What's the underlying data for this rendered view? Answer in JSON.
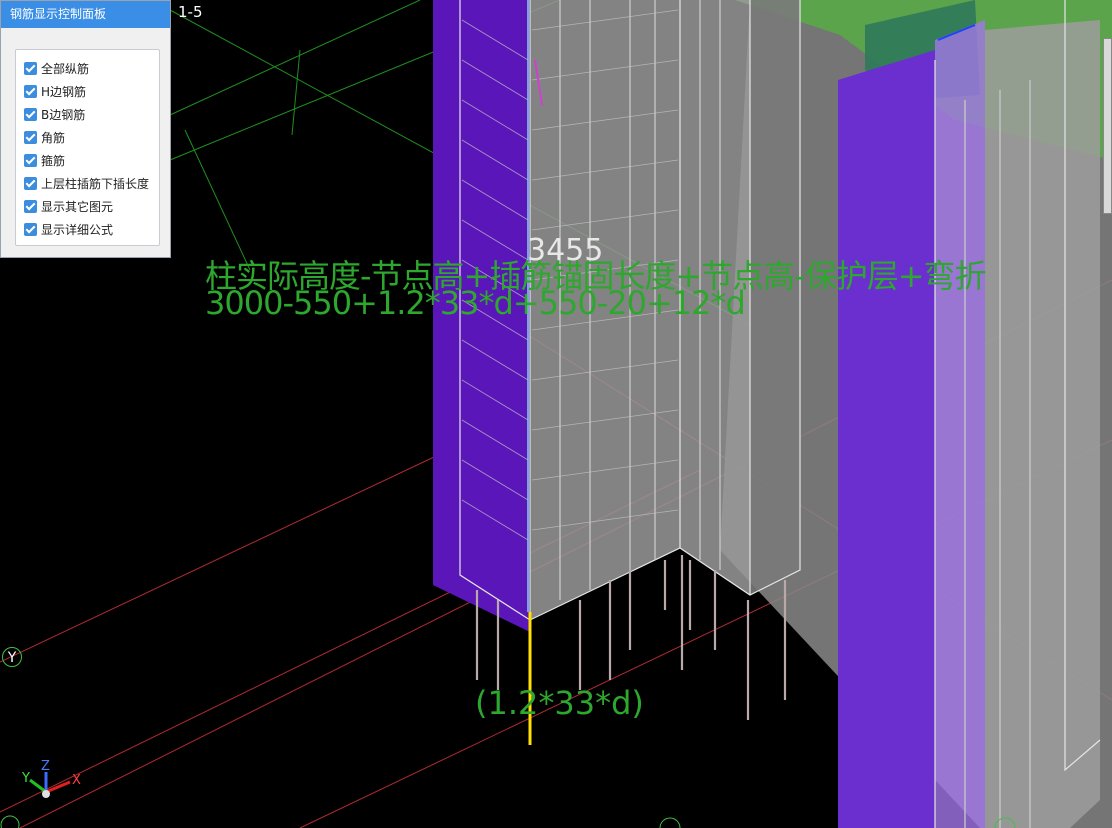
{
  "panel": {
    "title": "钢筋显示控制面板",
    "options": [
      {
        "label": "全部纵筋",
        "checked": true
      },
      {
        "label": "H边钢筋",
        "checked": true
      },
      {
        "label": "B边钢筋",
        "checked": true
      },
      {
        "label": "角筋",
        "checked": true
      },
      {
        "label": "箍筋",
        "checked": true
      },
      {
        "label": "上层柱插筋下插长度",
        "checked": true
      },
      {
        "label": "显示其它图元",
        "checked": true
      },
      {
        "label": "显示详细公式",
        "checked": true
      }
    ]
  },
  "viewport": {
    "grid_label": "1-5",
    "axis_bubble_left": "Y",
    "length_value": "3455",
    "formula_name": "柱实际高度-节点高+插筋锚固长度+节点高-保护层+弯折",
    "formula_expression": "3000-550+1.2*33*d+550-20+12*d",
    "anchor_formula": "(1.2*33*d)",
    "gizmo": {
      "x_label": "X",
      "y_label": "Y",
      "z_label": "Z"
    },
    "colors": {
      "background": "#000000",
      "formula_text": "#2ea72e",
      "column_purple": "#6f1fd0",
      "slab_green": "#5aa64a",
      "gray_concrete": "#8c8c8c",
      "grid_red": "#c0303a",
      "grid_green": "#2a9a2a",
      "highlight_bar": "#ffe000",
      "panel_title_bg": "#3a8ee6"
    }
  }
}
